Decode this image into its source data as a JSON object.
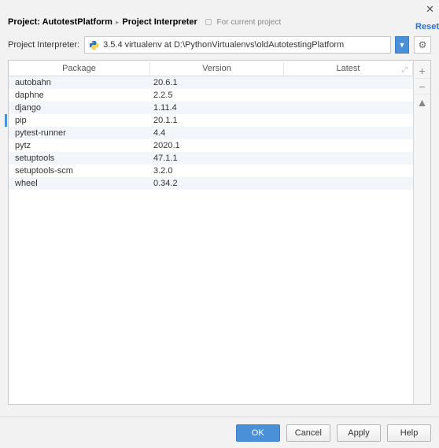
{
  "breadcrumb": {
    "project_label": "Project:",
    "project_name": "AutotestPlatform",
    "current": "Project Interpreter",
    "for_current_project": "For current project"
  },
  "reset_label": "Reset",
  "interpreter": {
    "label": "Project Interpreter:",
    "value": "3.5.4 virtualenv at D:\\PythonVirtualenvs\\oldAutotestingPlatform"
  },
  "columns": {
    "package": "Package",
    "version": "Version",
    "latest": "Latest"
  },
  "packages": [
    {
      "name": "autobahn",
      "version": "20.6.1",
      "latest": ""
    },
    {
      "name": "daphne",
      "version": "2.2.5",
      "latest": ""
    },
    {
      "name": "django",
      "version": "1.11.4",
      "latest": ""
    },
    {
      "name": "pip",
      "version": "20.1.1",
      "latest": ""
    },
    {
      "name": "pytest-runner",
      "version": "4.4",
      "latest": ""
    },
    {
      "name": "pytz",
      "version": "2020.1",
      "latest": ""
    },
    {
      "name": "setuptools",
      "version": "47.1.1",
      "latest": ""
    },
    {
      "name": "setuptools-scm",
      "version": "3.2.0",
      "latest": ""
    },
    {
      "name": "wheel",
      "version": "0.34.2",
      "latest": ""
    }
  ],
  "buttons": {
    "ok": "OK",
    "cancel": "Cancel",
    "apply": "Apply",
    "help": "Help"
  }
}
